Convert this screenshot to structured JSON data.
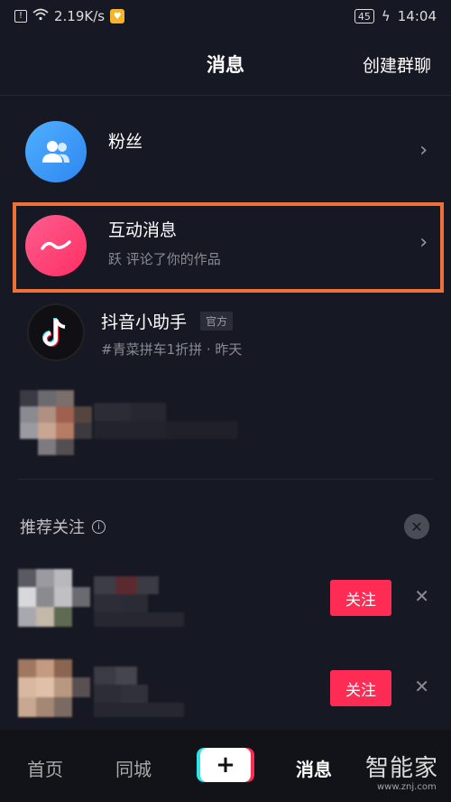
{
  "status": {
    "network_speed": "2.19K/s",
    "battery": "45",
    "time": "14:04"
  },
  "header": {
    "title": "消息",
    "action": "创建群聊"
  },
  "rows": {
    "fans": {
      "title": "粉丝"
    },
    "interaction": {
      "title": "互动消息",
      "subtitle": "跃 评论了你的作品"
    },
    "assistant": {
      "title": "抖音小助手",
      "tag": "官方",
      "subtitle": "#青菜拼车1折拼 · 昨天"
    }
  },
  "recommend": {
    "title": "推荐关注",
    "follow_label": "关注"
  },
  "nav": {
    "home": "首页",
    "city": "同城",
    "plus": "+",
    "messages": "消息"
  },
  "watermark": {
    "text": "智能家",
    "url": "www.znj.com"
  }
}
